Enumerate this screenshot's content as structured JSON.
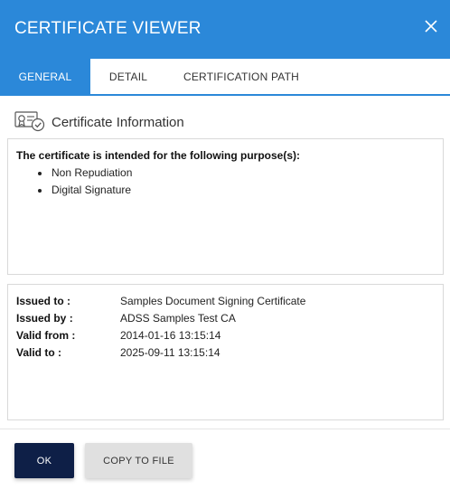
{
  "header": {
    "title": "CERTIFICATE VIEWER",
    "close_icon": "close-icon"
  },
  "tabs": [
    {
      "label": "GENERAL",
      "active": true
    },
    {
      "label": "DETAIL",
      "active": false
    },
    {
      "label": "CERTIFICATION PATH",
      "active": false
    }
  ],
  "section": {
    "icon": "certificate-icon",
    "title": "Certificate Information"
  },
  "purpose": {
    "heading": "The certificate is intended for the following purpose(s):",
    "items": [
      "Non Repudiation",
      "Digital Signature"
    ]
  },
  "info": {
    "rows": [
      {
        "label": "Issued to :",
        "value": "Samples Document Signing Certificate"
      },
      {
        "label": "Issued by :",
        "value": "ADSS Samples Test CA"
      },
      {
        "label": "Valid from :",
        "value": "2014-01-16 13:15:14"
      },
      {
        "label": "Valid to :",
        "value": "2025-09-11 13:15:14"
      }
    ]
  },
  "footer": {
    "ok_label": "OK",
    "copy_label": "COPY TO FILE"
  },
  "colors": {
    "accent": "#2b88d9",
    "primary_button": "#0e1f47",
    "secondary_button": "#e0e0e0"
  }
}
